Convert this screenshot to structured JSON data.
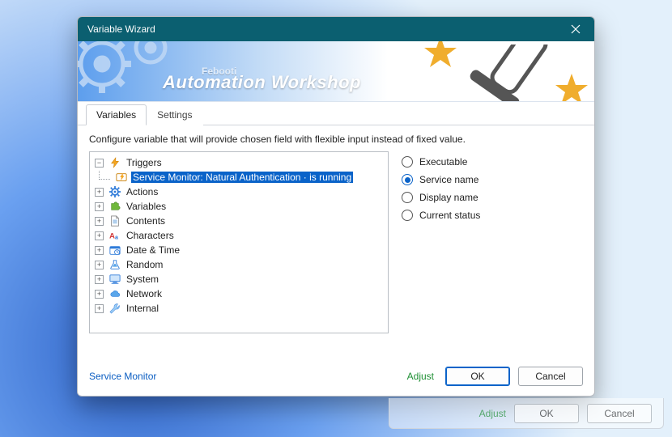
{
  "window": {
    "title": "Variable Wizard",
    "close_icon": "close"
  },
  "banner": {
    "brand": "Febooti",
    "product": "Automation Workshop"
  },
  "tabs": {
    "active": "Variables",
    "items": [
      "Variables",
      "Settings"
    ]
  },
  "description": "Configure variable that will provide chosen field with flexible input instead of fixed value.",
  "tree": {
    "root": [
      {
        "icon": "bolt",
        "label": "Triggers",
        "expanded": true,
        "children": [
          {
            "icon": "service",
            "label": "Service Monitor: Natural Authentication · is running",
            "selected": true
          }
        ]
      },
      {
        "icon": "gear",
        "label": "Actions",
        "expanded": false
      },
      {
        "icon": "puzzle",
        "label": "Variables",
        "expanded": false
      },
      {
        "icon": "doc",
        "label": "Contents",
        "expanded": false
      },
      {
        "icon": "chars",
        "label": "Characters",
        "expanded": false
      },
      {
        "icon": "clock",
        "label": "Date & Time",
        "expanded": false
      },
      {
        "icon": "flask",
        "label": "Random",
        "expanded": false
      },
      {
        "icon": "monitor",
        "label": "System",
        "expanded": false
      },
      {
        "icon": "cloud",
        "label": "Network",
        "expanded": false
      },
      {
        "icon": "wrench",
        "label": "Internal",
        "expanded": false
      }
    ]
  },
  "radios": {
    "items": [
      {
        "id": "executable",
        "label": "Executable",
        "checked": false
      },
      {
        "id": "service-name",
        "label": "Service name",
        "checked": true
      },
      {
        "id": "display-name",
        "label": "Display name",
        "checked": false
      },
      {
        "id": "current-status",
        "label": "Current status",
        "checked": false
      }
    ]
  },
  "footer": {
    "service_link": "Service Monitor",
    "adjust_label": "Adjust",
    "ok_label": "OK",
    "cancel_label": "Cancel"
  }
}
